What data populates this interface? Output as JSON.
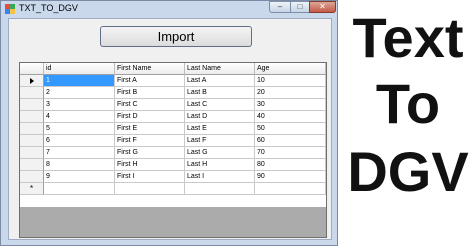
{
  "window": {
    "title": "TXT_TO_DGV"
  },
  "import_button": {
    "label": "Import"
  },
  "grid": {
    "columns": [
      "id",
      "First Name",
      "Last Name",
      "Age"
    ],
    "rows": [
      {
        "id": "1",
        "first": "First A",
        "last": "Last A",
        "age": "10"
      },
      {
        "id": "2",
        "first": "First B",
        "last": "Last B",
        "age": "20"
      },
      {
        "id": "3",
        "first": "First C",
        "last": "Last C",
        "age": "30"
      },
      {
        "id": "4",
        "first": "First D",
        "last": "Last D",
        "age": "40"
      },
      {
        "id": "5",
        "first": "First E",
        "last": "Last E",
        "age": "50"
      },
      {
        "id": "6",
        "first": "First F",
        "last": "Last F",
        "age": "60"
      },
      {
        "id": "7",
        "first": "First G",
        "last": "Last G",
        "age": "70"
      },
      {
        "id": "8",
        "first": "First H",
        "last": "Last H",
        "age": "80"
      },
      {
        "id": "9",
        "first": "First I",
        "last": "Last I",
        "age": "90"
      }
    ],
    "new_row_marker": "*"
  },
  "overlay": {
    "line1": "Text",
    "line2": "To",
    "line3": "DGV"
  },
  "colors": {
    "selection": "#3399ff",
    "grid_background": "#ababab"
  }
}
